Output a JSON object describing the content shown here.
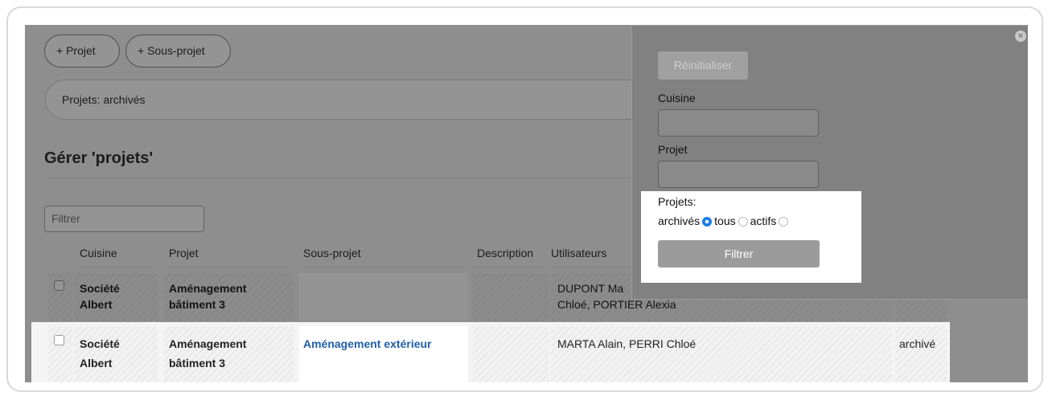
{
  "toolbar": {
    "add_project_label": "+ Projet",
    "add_subproject_label": "+ Sous-projet"
  },
  "breadcrumb": {
    "text": "Projets: archivés"
  },
  "page": {
    "title": "Gérer 'projets'"
  },
  "filter": {
    "placeholder": "Filtrer"
  },
  "table": {
    "columns": [
      "Cuisine",
      "Projet",
      "Sous-projet",
      "Description",
      "Utilisateurs"
    ],
    "rows": [
      {
        "cuisine": [
          "Société",
          "Albert"
        ],
        "projet": [
          "Aménagement",
          "bâtiment 3"
        ],
        "sous_projet": "",
        "description": "",
        "utilisateurs": [
          "DUPONT Ma",
          "Chloé, PORTIER Alexia"
        ],
        "status": ""
      },
      {
        "cuisine": [
          "Société",
          "Albert"
        ],
        "projet": [
          "Aménagement",
          "bâtiment 3"
        ],
        "sous_projet": "Aménagement extérieur",
        "description": "",
        "utilisateurs": [
          "MARTA Alain, PERRI Chloé"
        ],
        "status": "archivé"
      }
    ]
  },
  "filter_panel": {
    "reset_label": "Réinitialiser",
    "cuisine_label": "Cuisine",
    "projet_label": "Projet",
    "projets_label": "Projets:",
    "options": {
      "archives": "archivés",
      "tous": "tous",
      "actifs": "actifs"
    },
    "selected_option": "tous",
    "submit_label": "Filtrer",
    "close_glyph": "×"
  },
  "colors": {
    "link": "#1f5fa8",
    "radio_selected": "#1a7ce8"
  }
}
